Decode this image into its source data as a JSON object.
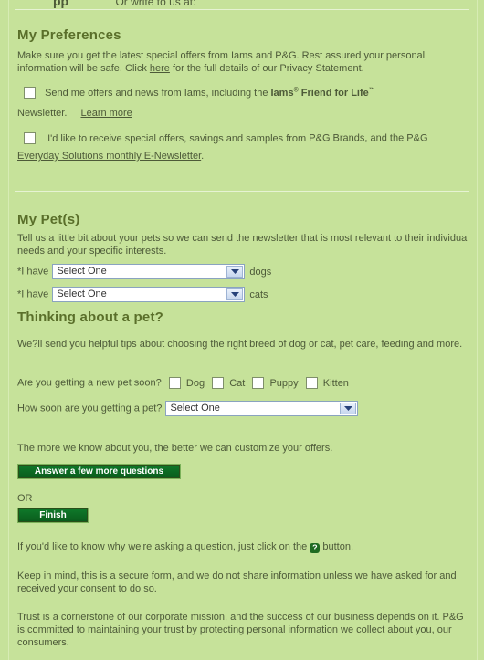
{
  "top_fragment": {
    "left": "pp",
    "right": "Or write to us at:"
  },
  "preferences": {
    "heading": "My Preferences",
    "intro_before_link": "Make sure you get the latest special offers from Iams and P&G. Rest assured your personal information will be safe. Click ",
    "here_link": "here",
    "intro_after_link": " for the full details of our Privacy Statement.",
    "iams_offer_prefix": "Send me offers and news from Iams, including the ",
    "iams_brand": "Iams",
    "registered": "®",
    "friend_for_life": " Friend for Life",
    "trademark": "™",
    "newsletter_word": "Newsletter.",
    "learn_more": "Learn more",
    "pg_offer_text": "I'd like to receive special offers, savings and samples from ",
    "pg_brands_link": "P&G Brands",
    "pg_offer_mid": ", and the ",
    "pg_everyday_link": "P&G Everyday Solutions monthly E-Newsletter",
    "pg_offer_end": "."
  },
  "pets": {
    "heading": "My Pet(s)",
    "intro": "Tell us a little bit about your pets so we can send the newsletter that is most relevant to their individual needs and your specific interests.",
    "i_have": "*I have",
    "dogs_select": "Select One",
    "dogs_label": "dogs",
    "cats_select": "Select One",
    "cats_label": "cats"
  },
  "thinking": {
    "heading": "Thinking about a pet?",
    "intro": "We?ll send you helpful tips about choosing the right breed of dog or cat, pet care, feeding and more.",
    "new_pet_question": "Are you getting a new pet soon?",
    "options": [
      "Dog",
      "Cat",
      "Puppy",
      "Kitten"
    ],
    "how_soon_label": "How soon are you getting a pet?",
    "how_soon_select": "Select One"
  },
  "footer": {
    "more_we_know": "The more we know about you, the better we can customize your offers.",
    "answer_button": "Answer a few more questions",
    "or": "OR",
    "finish_button": "Finish",
    "why_before": "If you'd like to know why we're asking a question, just click on the",
    "why_after": "button.",
    "question_icon_glyph": "?",
    "secure_text": "Keep in mind, this is a secure form, and we do not share information unless we have asked for and received your consent to do so.",
    "trust_text": "Trust is a cornerstone of our corporate mission, and the success of our business depends on it. P&G is committed to maintaining your trust by protecting personal information we collect about you, our consumers."
  }
}
